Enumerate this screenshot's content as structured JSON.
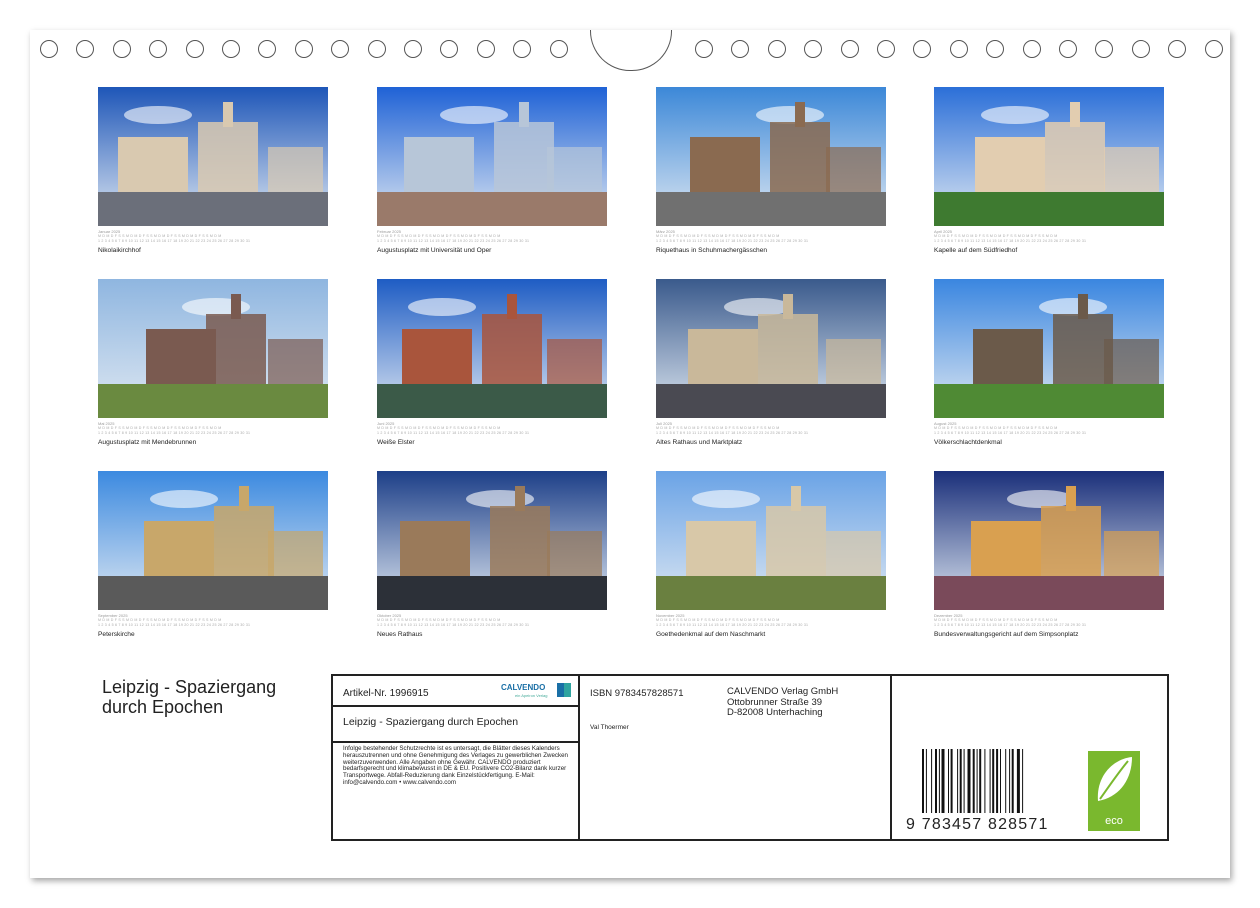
{
  "tiles": [
    {
      "month": "Januar 2025",
      "caption": "Nikolaikirchhof",
      "sky": "#1e56b8",
      "ground": "#6b6f7a",
      "bld": "#d9c9b0"
    },
    {
      "month": "Februar 2025",
      "caption": "Augustusplatz mit Universität und Oper",
      "sky": "#1f62d6",
      "ground": "#9a7a6a",
      "bld": "#b7c6d8"
    },
    {
      "month": "März 2025",
      "caption": "Riquethaus in Schuhmachergässchen",
      "sky": "#3c88d8",
      "ground": "#707070",
      "bld": "#8a6a50"
    },
    {
      "month": "April 2025",
      "caption": "Kapelle auf dem Südfriedhof",
      "sky": "#2b6fd8",
      "ground": "#3e7a30",
      "bld": "#e2cdb0"
    },
    {
      "month": "Mai 2025",
      "caption": "Augustusplatz mit Mendebrunnen",
      "sky": "#8fb6e0",
      "ground": "#6a8a40",
      "bld": "#7a5a50"
    },
    {
      "month": "Juni 2025",
      "caption": "Weiße Elster",
      "sky": "#1e5cc4",
      "ground": "#3b5a48",
      "bld": "#a9553c"
    },
    {
      "month": "Juli 2025",
      "caption": "Altes Rathaus und Marktplatz",
      "sky": "#3a5a8c",
      "ground": "#4a4a52",
      "bld": "#c9b89a"
    },
    {
      "month": "August 2025",
      "caption": "Völkerschlachtdenkmal",
      "sky": "#3a86e0",
      "ground": "#4f8a34",
      "bld": "#6b5a4a"
    },
    {
      "month": "September 2025",
      "caption": "Peterskirche",
      "sky": "#3c8ae0",
      "ground": "#5a5a5a",
      "bld": "#c8a76a"
    },
    {
      "month": "Oktober 2025",
      "caption": "Neues Rathaus",
      "sky": "#1d3f88",
      "ground": "#2c3038",
      "bld": "#9a7a5a"
    },
    {
      "month": "November 2025",
      "caption": "Goethedenkmal auf dem Naschmarkt",
      "sky": "#6aa3e6",
      "ground": "#6a8040",
      "bld": "#d8c8a8"
    },
    {
      "month": "Dezember 2025",
      "caption": "Bundesverwaltungsgericht auf dem Simpsonplatz",
      "sky": "#1a2f7a",
      "ground": "#7a4a5a",
      "bld": "#d9a050"
    }
  ],
  "days_row": "M D M D F S S M D M D F S S M D M D F S S M D M D F S S M D M",
  "nums_row": "1 2 3 4 5 6 7 8 9 10 11 12 13 14 15 16 17 18 19 20 21 22 23 24 25 26 27 28 29 30 31",
  "title": "Leipzig - Spaziergang durch Epochen",
  "info": {
    "artikel": "Artikel-Nr. 1996915",
    "logo_text": "CALVENDO",
    "logo_sub": "ein Apeiron Verlag",
    "box_title": "Leipzig - Spaziergang durch Epochen",
    "legal": "Infolge bestehender Schutzrechte ist es untersagt, die Blätter dieses Kalenders herauszutrennen und ohne Genehmigung des Verlages zu gewerblichen Zwecken weiterzuverwenden. Alle Angaben ohne Gewähr. CALVENDO produziert bedarfsgerecht und klimabewusst in DE & EU. Positivere CO2-Bilanz dank kurzer Transportwege. Abfall-Reduzierung dank Einzelstückfertigung. E-Mail: info@calvendo.com • www.calvendo.com",
    "isbn": "ISBN 9783457828571",
    "publisher_line1": "CALVENDO Verlag GmbH",
    "publisher_line2": "Ottobrunner Straße 39",
    "publisher_line3": "D-82008 Unterhaching",
    "author": "Val Thoermer",
    "barcode_digits": "9 783457 828571",
    "eco_label": "eco"
  },
  "colors": {
    "eco_green": "#7ab82e",
    "calvendo_blue": "#1a6fa6"
  }
}
